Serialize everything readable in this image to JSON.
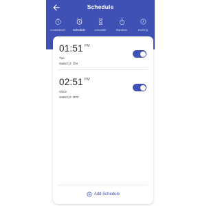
{
  "header": {
    "title": "Schedule"
  },
  "tabs": [
    {
      "label": "Countdown",
      "icon": "timer-icon",
      "active": false
    },
    {
      "label": "Schedule",
      "icon": "alarm-clock-icon",
      "active": true
    },
    {
      "label": "Circulate",
      "icon": "hourglass-icon",
      "active": false
    },
    {
      "label": "Random",
      "icon": "stopwatch-icon",
      "active": false
    },
    {
      "label": "Inching",
      "icon": "clock-icon",
      "active": false
    }
  ],
  "schedules": [
    {
      "time": "01:51",
      "ampm": "PM",
      "repeat": "Tue",
      "action": "Switch 2: ON",
      "enabled": true
    },
    {
      "time": "02:51",
      "ampm": "PM",
      "repeat": "Once",
      "action": "Switch 2: OFF",
      "enabled": true
    }
  ],
  "add_schedule": {
    "label": "Add Schedule",
    "icon": "plus-circle-icon"
  },
  "colors": {
    "primary": "#3f51b5",
    "background": "#ffffff"
  }
}
